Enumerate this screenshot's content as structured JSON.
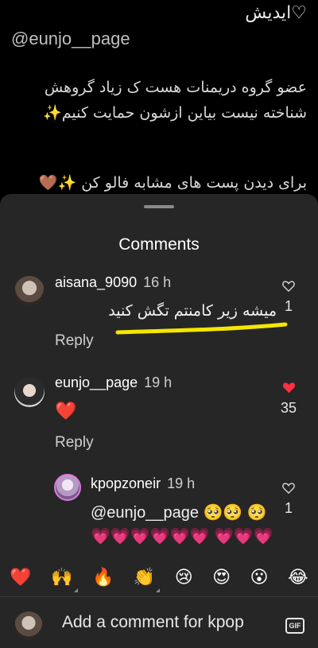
{
  "caption": {
    "line1": "ایدیش♡",
    "handle": "@eunjo__page",
    "para": "عضو گروه دریمنات هست ک زیاد گروهش شناخته نیست بیاین ازشون حمایت کنیم✨",
    "bottom": "برای دیدن پست های مشابه فالو کن ✨🤎"
  },
  "sheet": {
    "title": "Comments"
  },
  "comments": [
    {
      "username": "aisana_9090",
      "time": "16 h",
      "text": "میشه زیر کامنتم تگش کنید",
      "likes": "1",
      "liked": false,
      "reply": "Reply"
    },
    {
      "username": "eunjo__page",
      "time": "19 h",
      "text": "❤️",
      "likes": "35",
      "liked": true,
      "reply": "Reply"
    },
    {
      "username": "kpopzoneir",
      "time": "19 h",
      "text": "@eunjo__page 🥺🥺 🥺💗💗💗💗💗💗 💗💗💗",
      "likes": "1",
      "liked": false
    }
  ],
  "emojis": [
    "❤️",
    "🙌",
    "🔥",
    "👏",
    "😢",
    "😍",
    "😮",
    "😂"
  ],
  "compose": {
    "placeholder": "Add a comment for kpop",
    "gif_label": "GIF"
  },
  "colors": {
    "accent_red": "#ff3040",
    "annotation_yellow": "#f5e600"
  }
}
